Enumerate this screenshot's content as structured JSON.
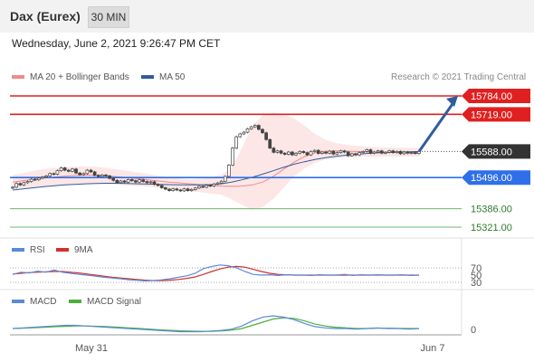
{
  "header": {
    "title": "Dax (Eurex)",
    "timeframe": "30 MIN"
  },
  "datetime": "Wednesday, June 2, 2021 9:26:47 PM CET",
  "main_legend": {
    "bollinger": "MA 20 + Bollinger Bands",
    "ma50": "MA 50",
    "credit": "Research © 2021 Trading Central"
  },
  "rsi_legend": {
    "rsi": "RSI",
    "ma": "9MA"
  },
  "macd_legend": {
    "macd": "MACD",
    "signal": "MACD Signal"
  },
  "colors": {
    "resistance": "#e02020",
    "current": "#333333",
    "support": "#2f6fe8",
    "target": "#6ab86a",
    "arrow": "#2f5d9c",
    "rsi": "#5b8ad6",
    "rsi_ma": "#d32f2f",
    "macd": "#5b8ad6",
    "macd_signal": "#4caf3d"
  },
  "chart_data": [
    {
      "type": "candlestick",
      "panel": "price",
      "levels": [
        {
          "value": 15784.0,
          "label": "15784.00",
          "kind": "resistance"
        },
        {
          "value": 15719.0,
          "label": "15719.00",
          "kind": "resistance"
        },
        {
          "value": 15588.0,
          "label": "15588.00",
          "kind": "current"
        },
        {
          "value": 15496.0,
          "label": "15496.00",
          "kind": "support"
        },
        {
          "value": 15386.0,
          "label": "15386.00",
          "kind": "target"
        },
        {
          "value": 15321.0,
          "label": "15321.00",
          "kind": "target"
        }
      ],
      "x_ticks": [
        "May 31",
        "Jun 7"
      ],
      "close": [
        15462,
        15475,
        15470,
        15478,
        15482,
        15490,
        15488,
        15494,
        15498,
        15502,
        15510,
        15508,
        15520,
        15530,
        15522,
        15518,
        15526,
        15512,
        15506,
        15510,
        15522,
        15516,
        15504,
        15500,
        15505,
        15502,
        15493,
        15486,
        15478,
        15484,
        15480,
        15489,
        15485,
        15480,
        15488,
        15482,
        15478,
        15481,
        15472,
        15468,
        15460,
        15455,
        15450,
        15456,
        15452,
        15449,
        15456,
        15450,
        15454,
        15459,
        15465,
        15462,
        15469,
        15466,
        15473,
        15477,
        15483,
        15500,
        15540,
        15600,
        15640,
        15650,
        15656,
        15668,
        15675,
        15680,
        15666,
        15654,
        15630,
        15600,
        15585,
        15590,
        15582,
        15578,
        15586,
        15576,
        15582,
        15588,
        15584,
        15576,
        15588,
        15592,
        15581,
        15586,
        15582,
        15589,
        15579,
        15584,
        15590,
        15586,
        15573,
        15580,
        15576,
        15584,
        15588,
        15594,
        15582,
        15586,
        15590,
        15582,
        15585,
        15590,
        15584,
        15588,
        15580,
        15586,
        15582,
        15584,
        15581,
        15588
      ],
      "ma20": [
        15480,
        15485,
        15490,
        15494,
        15498,
        15501,
        15503,
        15505,
        15504,
        15502,
        15499,
        15496,
        15492,
        15488,
        15484,
        15480,
        15477,
        15474,
        15471,
        15468,
        15466,
        15465,
        15466,
        15470,
        15480,
        15500,
        15525,
        15550,
        15570,
        15583,
        15589,
        15590,
        15589,
        15588,
        15587,
        15586,
        15585,
        15585,
        15584,
        15584
      ],
      "ma50": [
        15452,
        15456,
        15460,
        15464,
        15467,
        15470,
        15472,
        15474,
        15475,
        15476,
        15476,
        15475,
        15474,
        15473,
        15472,
        15471,
        15470,
        15470,
        15470,
        15471,
        15474,
        15480,
        15488,
        15497,
        15508,
        15520,
        15532,
        15543,
        15552,
        15560,
        15566,
        15571,
        15575,
        15578,
        15581,
        15583,
        15585,
        15586,
        15587,
        15588
      ],
      "bb_upper": [
        15505,
        15512,
        15520,
        15526,
        15530,
        15532,
        15534,
        15535,
        15534,
        15530,
        15525,
        15520,
        15514,
        15508,
        15502,
        15497,
        15493,
        15490,
        15492,
        15497,
        15506,
        15530,
        15600,
        15680,
        15715,
        15725,
        15720,
        15705,
        15680,
        15650,
        15630,
        15618,
        15612,
        15608,
        15605,
        15603,
        15602,
        15601,
        15601,
        15600
      ],
      "bb_lower": [
        15455,
        15458,
        15460,
        15462,
        15466,
        15470,
        15472,
        15474,
        15474,
        15473,
        15471,
        15468,
        15466,
        15463,
        15460,
        15456,
        15452,
        15448,
        15444,
        15440,
        15436,
        15420,
        15400,
        15382,
        15392,
        15420,
        15460,
        15500,
        15528,
        15548,
        15560,
        15565,
        15567,
        15568,
        15569,
        15570,
        15570,
        15570,
        15570,
        15570
      ],
      "forecast_target": 15784.0
    },
    {
      "type": "line",
      "panel": "rsi",
      "ticks": [
        "70",
        "50",
        "30"
      ],
      "series": [
        {
          "name": "RSI",
          "values": [
            52,
            58,
            56,
            61,
            58,
            64,
            58,
            55,
            52,
            50,
            47,
            44,
            42,
            40,
            37,
            36,
            34,
            35,
            37,
            40,
            44,
            48,
            55,
            68,
            74,
            78,
            76,
            70,
            60,
            52,
            50,
            51,
            49,
            51,
            50,
            50,
            49,
            51,
            50,
            50,
            52,
            49,
            51,
            50,
            51,
            50,
            50,
            51,
            49,
            50
          ]
        },
        {
          "name": "9MA",
          "values": [
            53,
            55,
            57,
            58,
            59,
            60,
            60,
            58,
            56,
            53,
            50,
            47,
            44,
            42,
            40,
            38,
            36,
            35,
            35,
            36,
            38,
            41,
            45,
            52,
            60,
            67,
            72,
            74,
            72,
            66,
            60,
            55,
            52,
            51,
            50,
            50,
            50,
            50,
            50,
            50,
            50,
            50,
            50,
            50,
            50,
            50,
            50,
            50,
            50,
            50
          ]
        }
      ]
    },
    {
      "type": "line",
      "panel": "macd",
      "ticks": [
        "0"
      ],
      "series": [
        {
          "name": "MACD",
          "values": [
            0,
            1,
            2,
            3,
            4,
            5,
            5,
            4,
            3,
            2,
            1,
            0,
            -1,
            -2,
            -3,
            -4,
            -5,
            -5,
            -5,
            -4,
            -3,
            -1,
            4,
            12,
            18,
            20,
            18,
            14,
            8,
            3,
            1,
            0,
            0,
            -1,
            0,
            1,
            0,
            0,
            -1,
            0
          ]
        },
        {
          "name": "MACD Signal",
          "values": [
            0,
            0.5,
            1.2,
            2,
            2.8,
            3.5,
            4,
            4,
            3.6,
            3,
            2.2,
            1.2,
            0.2,
            -0.8,
            -1.8,
            -2.8,
            -3.6,
            -4.2,
            -4.5,
            -4.4,
            -3.8,
            -2.6,
            0,
            5,
            10,
            15,
            17,
            16,
            12,
            7,
            4,
            2,
            1,
            0,
            0,
            0.4,
            0.5,
            0.3,
            0,
            0
          ]
        }
      ]
    }
  ]
}
